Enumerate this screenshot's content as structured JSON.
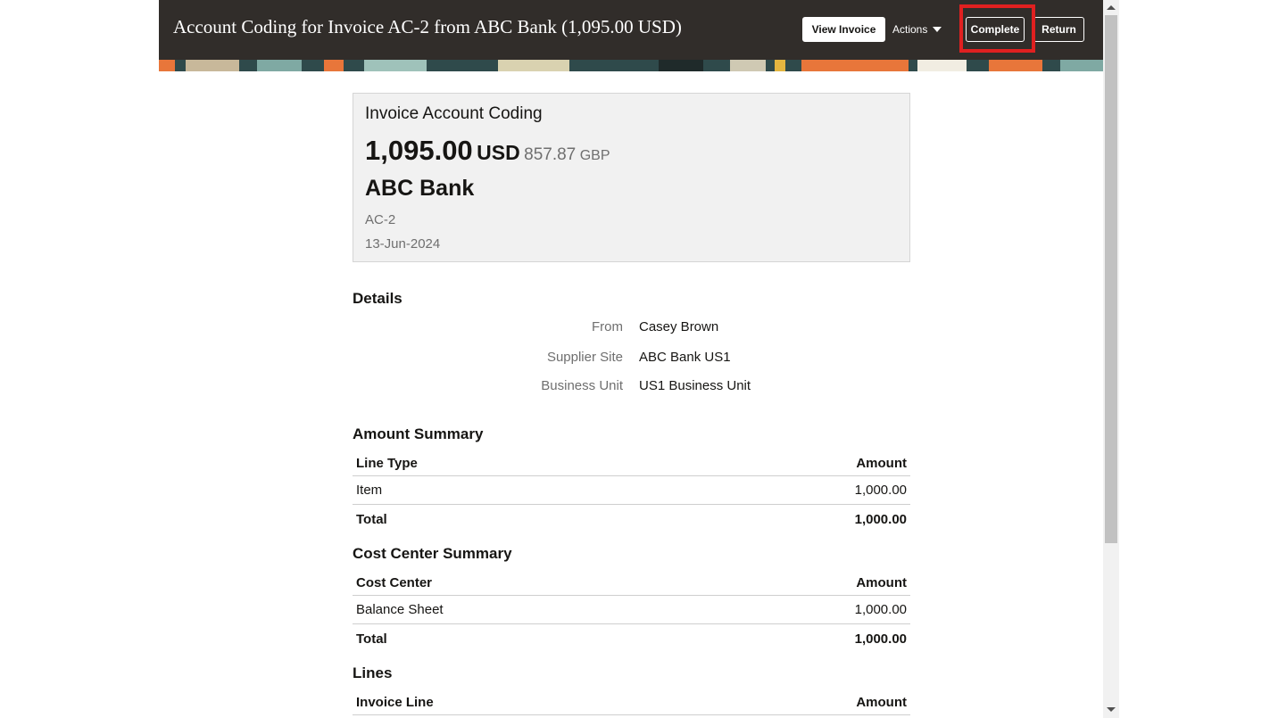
{
  "header": {
    "title": "Account Coding for Invoice AC-2 from ABC Bank (1,095.00 USD)",
    "buttons": {
      "view_invoice": "View Invoice",
      "actions": "Actions",
      "complete": "Complete",
      "return": "Return"
    }
  },
  "card": {
    "title": "Invoice Account Coding",
    "amount": "1,095.00",
    "currency": "USD",
    "alt_amount": "857.87",
    "alt_currency": "GBP",
    "supplier": "ABC Bank",
    "invoice_number": "AC-2",
    "invoice_date": "13-Jun-2024"
  },
  "details": {
    "heading": "Details",
    "rows": [
      {
        "label": "From",
        "value": "Casey Brown"
      },
      {
        "label": "Supplier Site",
        "value": "ABC Bank US1"
      },
      {
        "label": "Business Unit",
        "value": "US1 Business Unit"
      }
    ]
  },
  "amount_summary": {
    "heading": "Amount Summary",
    "columns": [
      "Line Type",
      "Amount"
    ],
    "rows": [
      {
        "label": "Item",
        "amount": "1,000.00"
      }
    ],
    "total": {
      "label": "Total",
      "amount": "1,000.00"
    }
  },
  "cost_center_summary": {
    "heading": "Cost Center Summary",
    "columns": [
      "Cost Center",
      "Amount"
    ],
    "rows": [
      {
        "label": "Balance Sheet",
        "amount": "1,000.00"
      }
    ],
    "total": {
      "label": "Total",
      "amount": "1,000.00"
    }
  },
  "lines": {
    "heading": "Lines",
    "columns": [
      "Invoice Line",
      "Amount"
    ]
  },
  "colors": {
    "header_bg": "#312d2a",
    "highlight": "#e02020",
    "card_bg": "#f1f1f1"
  }
}
